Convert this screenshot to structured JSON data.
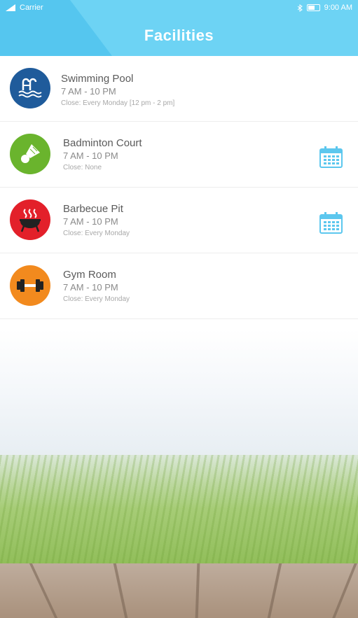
{
  "status_bar": {
    "carrier": "Carrier",
    "time": "9:00 AM"
  },
  "header": {
    "title": "Facilities"
  },
  "colors": {
    "accent": "#6dd3f4",
    "calendar": "#5cc7ee"
  },
  "facilities": [
    {
      "name": "Swimming Pool",
      "hours": "7 AM - 10 PM",
      "close": "Close: Every Monday [12 pm - 2 pm]",
      "icon": "swimming-pool-icon",
      "color": "#1f5b9b",
      "has_calendar": false
    },
    {
      "name": "Badminton Court",
      "hours": "7 AM - 10 PM",
      "close": "Close: None",
      "icon": "shuttlecock-icon",
      "color": "#6ab42d",
      "has_calendar": true
    },
    {
      "name": "Barbecue Pit",
      "hours": "7 AM - 10 PM",
      "close": "Close: Every Monday",
      "icon": "grill-icon",
      "color": "#e3202a",
      "has_calendar": true
    },
    {
      "name": "Gym Room",
      "hours": "7 AM - 10 PM",
      "close": "Close: Every Monday",
      "icon": "dumbbell-icon",
      "color": "#f28a1e",
      "has_calendar": false
    }
  ]
}
